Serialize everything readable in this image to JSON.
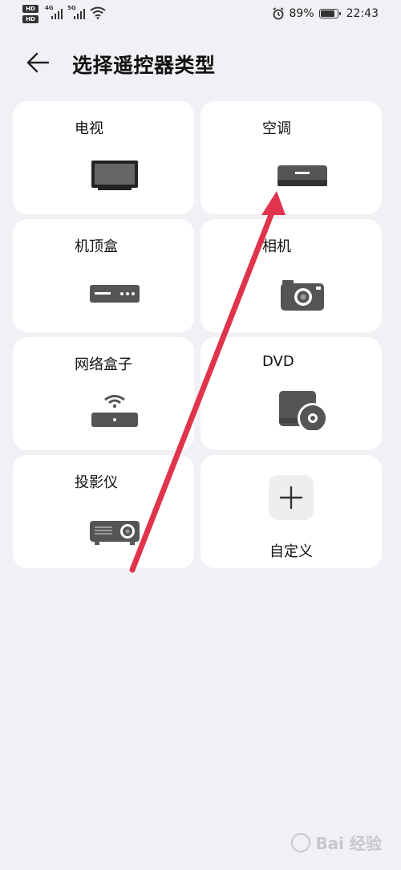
{
  "status_bar": {
    "hd1": "HD",
    "hd2": "HD",
    "net1": "4G",
    "net2": "5G",
    "battery_percent": "89%",
    "battery_level": 0.89,
    "time": "22:43"
  },
  "header": {
    "title": "选择遥控器类型"
  },
  "devices": [
    {
      "label": "电视",
      "icon": "tv-icon"
    },
    {
      "label": "空调",
      "icon": "air-conditioner-icon"
    },
    {
      "label": "机顶盒",
      "icon": "set-top-box-icon"
    },
    {
      "label": "相机",
      "icon": "camera-icon"
    },
    {
      "label": "网络盒子",
      "icon": "network-box-icon"
    },
    {
      "label": "DVD",
      "icon": "dvd-icon"
    },
    {
      "label": "投影仪",
      "icon": "projector-icon"
    }
  ],
  "custom": {
    "label": "自定义",
    "icon": "plus-icon"
  },
  "colors": {
    "background": "#f1f1f5",
    "card": "#ffffff",
    "icon": "#555555",
    "annotation_arrow": "#e0344c"
  },
  "watermark": {
    "text": "Bai 经验"
  }
}
